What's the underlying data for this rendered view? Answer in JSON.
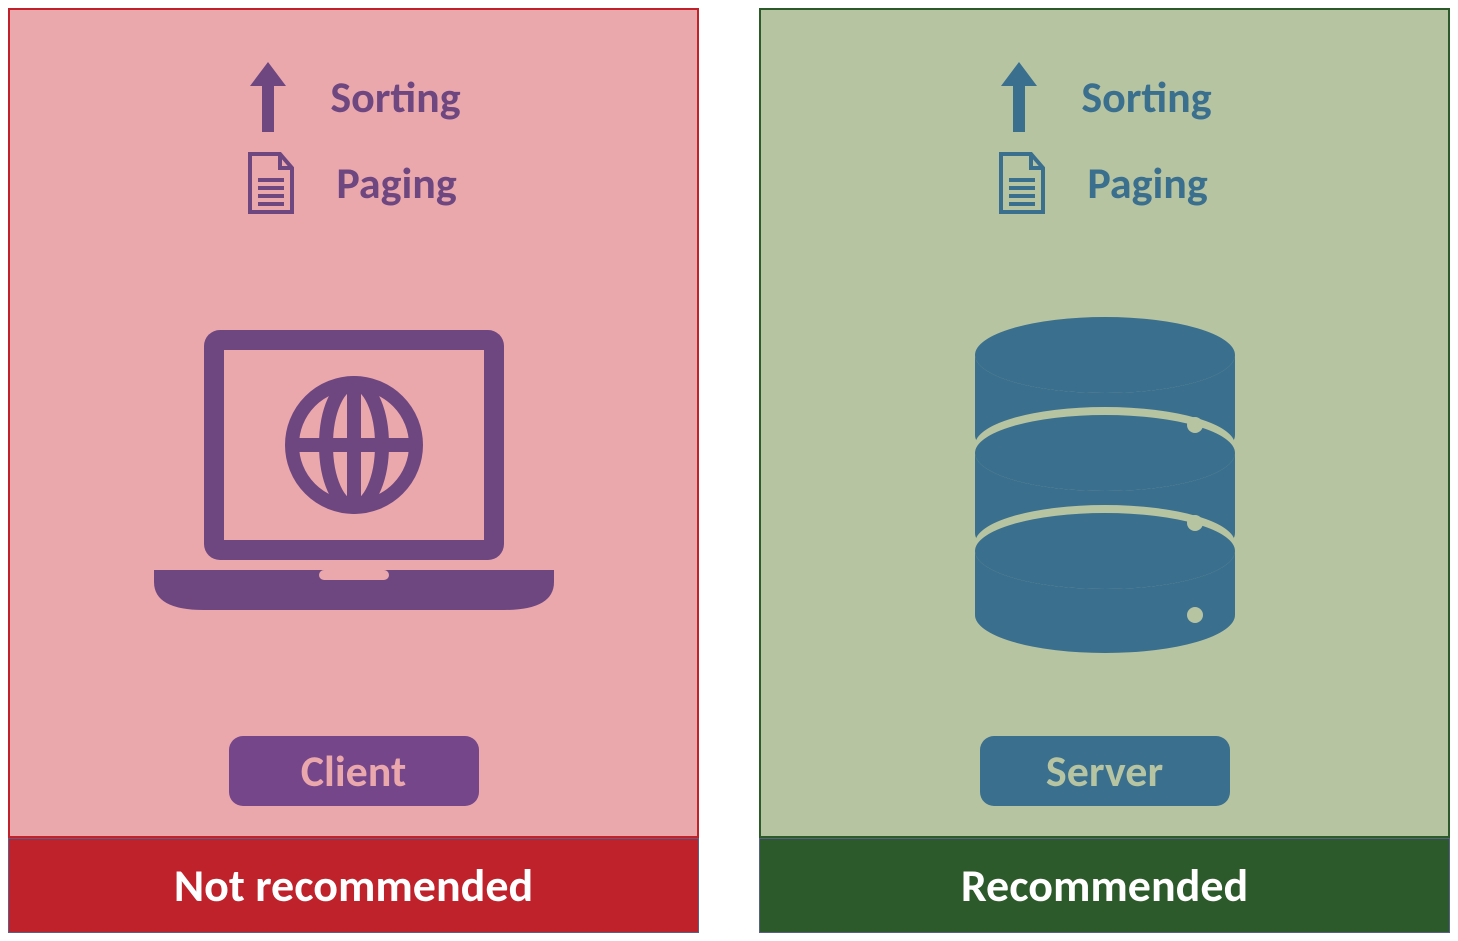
{
  "left": {
    "features": {
      "sorting": "Sorting",
      "paging": "Paging"
    },
    "pill": "Client",
    "footer": "Not recommended",
    "colors": {
      "bg": "#eaa8ad",
      "border": "#c0222b",
      "accent": "#6e4781",
      "pillTextBg": "#75468a"
    }
  },
  "right": {
    "features": {
      "sorting": "Sorting",
      "paging": "Paging"
    },
    "pill": "Server",
    "footer": "Recommended",
    "colors": {
      "bg": "#b6c4a2",
      "border": "#2d5a2a",
      "accent": "#3a6f8e"
    }
  }
}
